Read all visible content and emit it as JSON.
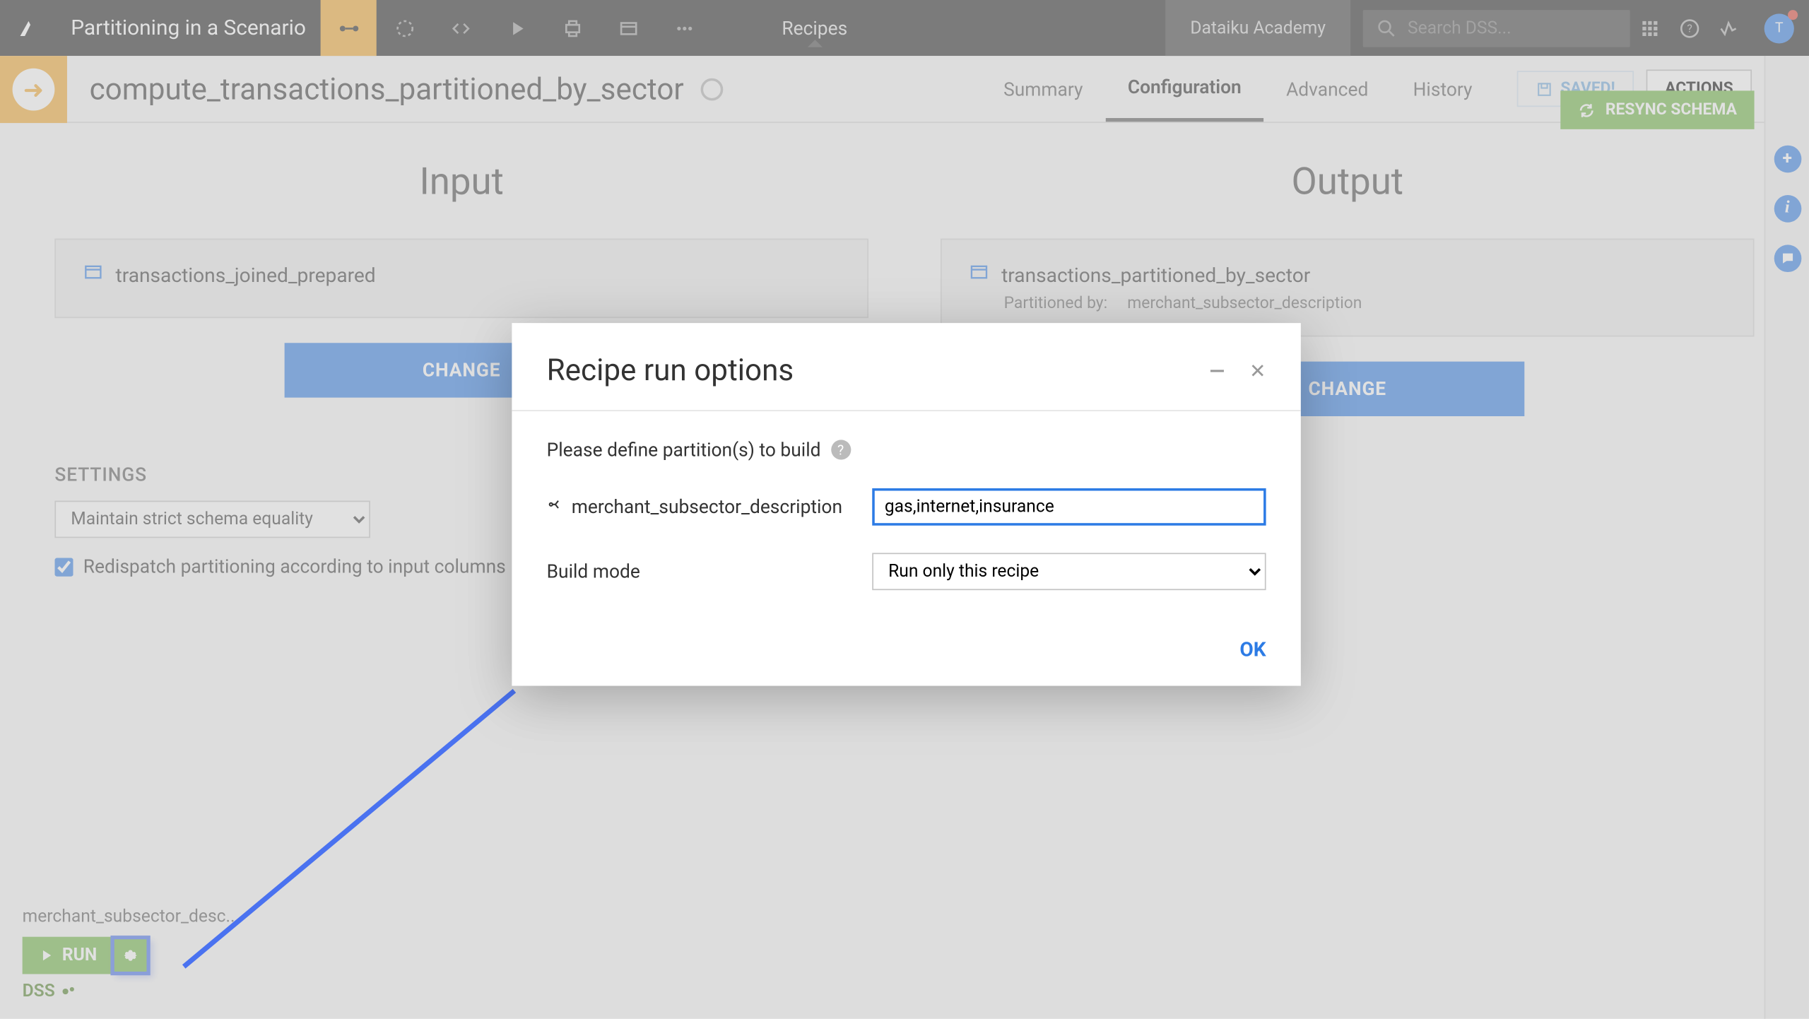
{
  "topbar": {
    "project_name": "Partitioning in a Scenario",
    "breadcrumb": "Recipes",
    "academy_label": "Dataiku Academy",
    "search_placeholder": "Search DSS...",
    "avatar_initial": "T"
  },
  "subhead": {
    "recipe_name": "compute_transactions_partitioned_by_sector",
    "tabs": {
      "summary": "Summary",
      "configuration": "Configuration",
      "advanced": "Advanced",
      "history": "History"
    },
    "saved_label": "SAVED!",
    "actions_label": "ACTIONS"
  },
  "io": {
    "input_heading": "Input",
    "output_heading": "Output",
    "input_dataset": "transactions_joined_prepared",
    "output_dataset": "transactions_partitioned_by_sector",
    "partitioned_by_label": "Partitioned by:",
    "partitioned_by_value": "merchant_subsector_description",
    "change_label": "CHANGE",
    "resync_label": "RESYNC SCHEMA"
  },
  "settings": {
    "heading": "SETTINGS",
    "schema_mode": "Maintain strict schema equality",
    "redispatch_label": "Redispatch partitioning according to input columns"
  },
  "runbar": {
    "truncated": "merchant_subsector_desc...",
    "run_label": "RUN",
    "engine_label": "DSS"
  },
  "modal": {
    "title": "Recipe run options",
    "hint": "Please define partition(s) to build",
    "dim_label": "merchant_subsector_description",
    "dim_value": "gas,internet,insurance",
    "build_mode_label": "Build mode",
    "build_mode_value": "Run only this recipe",
    "ok_label": "OK"
  }
}
